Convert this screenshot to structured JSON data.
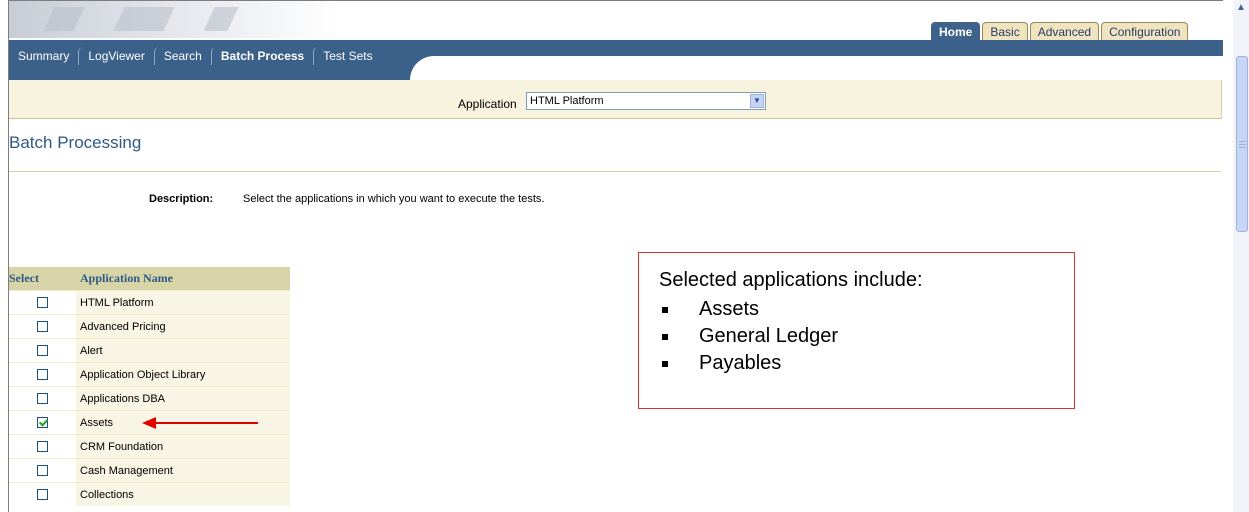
{
  "global_tabs": [
    {
      "label": "Home",
      "active": true
    },
    {
      "label": "Basic",
      "active": false
    },
    {
      "label": "Advanced",
      "active": false
    },
    {
      "label": "Configuration",
      "active": false
    }
  ],
  "sub_tabs": [
    {
      "label": "Summary",
      "active": false
    },
    {
      "label": "LogViewer",
      "active": false
    },
    {
      "label": "Search",
      "active": false
    },
    {
      "label": "Batch Process",
      "active": true
    },
    {
      "label": "Test Sets",
      "active": false
    }
  ],
  "application_bar": {
    "label": "Application",
    "selected": "HTML Platform"
  },
  "page": {
    "title": "Batch Processing",
    "description_label": "Description:",
    "description_text": "Select the applications in which you want to execute the tests."
  },
  "table": {
    "headers": {
      "select": "Select",
      "name": "Application Name"
    },
    "rows": [
      {
        "name": "HTML Platform",
        "checked": false
      },
      {
        "name": "Advanced Pricing",
        "checked": false
      },
      {
        "name": "Alert",
        "checked": false
      },
      {
        "name": "Application Object Library",
        "checked": false
      },
      {
        "name": "Applications DBA",
        "checked": false
      },
      {
        "name": "Assets",
        "checked": true
      },
      {
        "name": "CRM Foundation",
        "checked": false
      },
      {
        "name": "Cash Management",
        "checked": false
      },
      {
        "name": "Collections",
        "checked": false
      }
    ]
  },
  "callout": {
    "title": "Selected applications include:",
    "items": [
      "Assets",
      "General Ledger",
      "Payables"
    ]
  },
  "colors": {
    "nav_blue": "#3b6089",
    "title_blue": "#2f5a86",
    "table_header_bg": "#d7d4a7",
    "annotation_red": "#e10000"
  }
}
